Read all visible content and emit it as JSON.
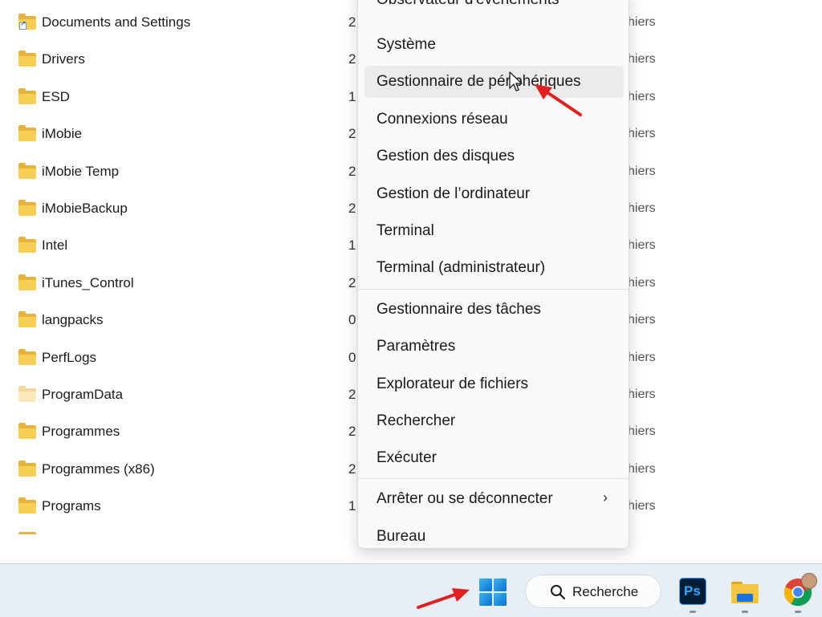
{
  "files": [
    {
      "name": "Documents and Settings",
      "date": "2",
      "type": "hiers",
      "folder": "shortcut"
    },
    {
      "name": "Drivers",
      "date": "2",
      "type": "hiers",
      "folder": "normal"
    },
    {
      "name": "ESD",
      "date": "1",
      "type": "hiers",
      "folder": "normal"
    },
    {
      "name": "iMobie",
      "date": "2",
      "type": "hiers",
      "folder": "normal"
    },
    {
      "name": "iMobie Temp",
      "date": "2",
      "type": "hiers",
      "folder": "normal"
    },
    {
      "name": "iMobieBackup",
      "date": "2",
      "type": "hiers",
      "folder": "normal"
    },
    {
      "name": "Intel",
      "date": "1",
      "type": "hiers",
      "folder": "normal"
    },
    {
      "name": "iTunes_Control",
      "date": "2",
      "type": "hiers",
      "folder": "normal"
    },
    {
      "name": "langpacks",
      "date": "0",
      "type": "hiers",
      "folder": "normal"
    },
    {
      "name": "PerfLogs",
      "date": "0",
      "type": "hiers",
      "folder": "normal"
    },
    {
      "name": "ProgramData",
      "date": "2",
      "type": "hiers",
      "folder": "pale"
    },
    {
      "name": "Programmes",
      "date": "2",
      "type": "hiers",
      "folder": "normal"
    },
    {
      "name": "Programmes (x86)",
      "date": "2",
      "type": "hiers",
      "folder": "normal"
    },
    {
      "name": "Programs",
      "date": "1",
      "type": "hiers",
      "folder": "normal"
    }
  ],
  "menu": {
    "items": [
      "Observateur d'événements",
      "Système",
      "Gestionnaire de périphériques",
      "Connexions réseau",
      "Gestion des disques",
      "Gestion de l’ordinateur",
      "Terminal",
      "Terminal (administrateur)",
      "Gestionnaire des tâches",
      "Paramètres",
      "Explorateur de fichiers",
      "Rechercher",
      "Exécuter",
      "Arrêter ou se déconnecter",
      "Bureau"
    ],
    "hovered": "Gestionnaire de périphériques",
    "submenu_chevron": "›"
  },
  "taskbar": {
    "search_label": "Recherche",
    "apps": [
      "windows-start-icon",
      "search-icon",
      "photoshop-icon",
      "file-explorer-icon",
      "chrome-icon"
    ],
    "photoshop_label": "Ps"
  },
  "colors": {
    "accent": "#0078d4",
    "annotation_arrow": "#e02020",
    "folder": "#f7cf57"
  }
}
